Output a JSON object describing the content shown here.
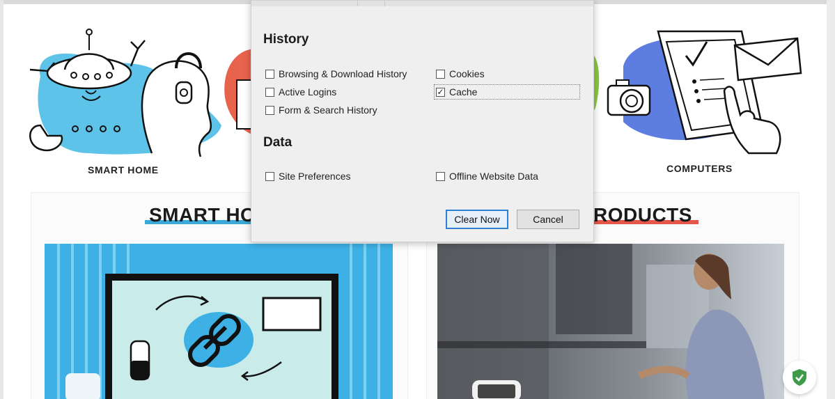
{
  "categories": {
    "left_label": "SMART HOME",
    "right_label": "COMPUTERS"
  },
  "sections": {
    "left_title": "SMART HO",
    "right_title": "RODUCTS"
  },
  "dialog": {
    "history_heading": "History",
    "data_heading": "Data",
    "options": {
      "browsing_history": {
        "label": "Browsing & Download History",
        "checked": false
      },
      "active_logins": {
        "label": "Active Logins",
        "checked": false
      },
      "form_search_history": {
        "label": "Form & Search History",
        "checked": false
      },
      "cookies": {
        "label": "Cookies",
        "checked": false
      },
      "cache": {
        "label": "Cache",
        "checked": true
      },
      "site_preferences": {
        "label": "Site Preferences",
        "checked": false
      },
      "offline_website_data": {
        "label": "Offline Website Data",
        "checked": false
      }
    },
    "clear_now_label": "Clear Now",
    "cancel_label": "Cancel",
    "check_mark": "✓"
  },
  "colors": {
    "accent_blue": "#3aa8d8",
    "accent_red": "#e5564b",
    "focus_blue": "#2f7fd0",
    "shield_green": "#3d9b49"
  },
  "icons": {
    "shield": "shield-check-icon"
  }
}
